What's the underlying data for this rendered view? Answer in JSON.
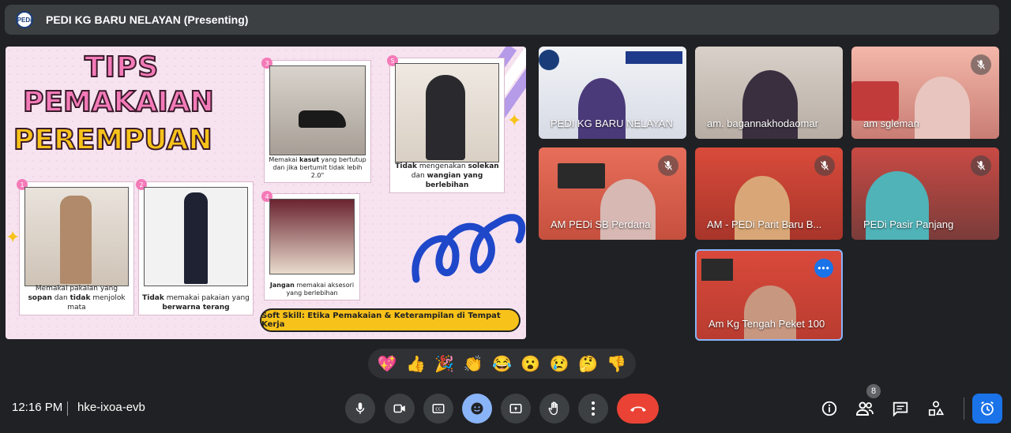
{
  "header": {
    "title": "PEDI KG BARU NELAYAN (Presenting)",
    "logo_text": "PEDi"
  },
  "slide": {
    "title_line1": "TIPS",
    "title_line2": "PEMAKAIAN",
    "title_line3": "PEREMPUAN",
    "cards": [
      {
        "num": "1",
        "caption_pre": "Memakai pakaian yang ",
        "caption_b1": "sopan",
        "caption_mid": " dan ",
        "caption_b2": "tidak",
        "caption_post": " menjolok mata"
      },
      {
        "num": "2",
        "caption_b1": "Tidak",
        "caption_mid": " memakai pakaian yang ",
        "caption_b2": "berwarna terang"
      },
      {
        "num": "3",
        "caption_pre": "Memakai ",
        "caption_b1": "kasut",
        "caption_post": " yang bertutup dan jika bertumit tidak lebih 2.0\""
      },
      {
        "num": "4",
        "caption_b1": "Jangan",
        "caption_post": " memakai aksesori yang berlebihan"
      },
      {
        "num": "5",
        "caption_b1": "Tidak",
        "caption_mid": " mengenakan ",
        "caption_b2": "solekan",
        "caption_mid2": " dan ",
        "caption_b3": "wangian yang berlebihan"
      }
    ],
    "soft_skill": "Soft Skill: Etika Pemakaian & Keterampilan di Tempat Kerja"
  },
  "participants": [
    {
      "name": "PEDI KG BARU NELAYAN",
      "muted": false
    },
    {
      "name": "am. bagannakhodaomar",
      "muted": false
    },
    {
      "name": "am sgleman",
      "muted": true
    },
    {
      "name": "AM PEDi SB Perdana",
      "muted": true
    },
    {
      "name": "AM - PEDi Parit Baru B...",
      "muted": true
    },
    {
      "name": "PEDi Pasir Panjang",
      "muted": true
    },
    {
      "name": "Am Kg Tengah Peket 100",
      "muted": false
    }
  ],
  "reactions": [
    "💖",
    "👍",
    "🎉",
    "👏",
    "😂",
    "😮",
    "😢",
    "🤔",
    "👎"
  ],
  "footer": {
    "time": "12:16 PM",
    "meeting_code": "hke-ixoa-evb",
    "people_count": "8"
  },
  "colors": {
    "background": "#202124",
    "accent": "#8ab4f8",
    "hangup": "#ea4335",
    "primary": "#1a73e8"
  }
}
